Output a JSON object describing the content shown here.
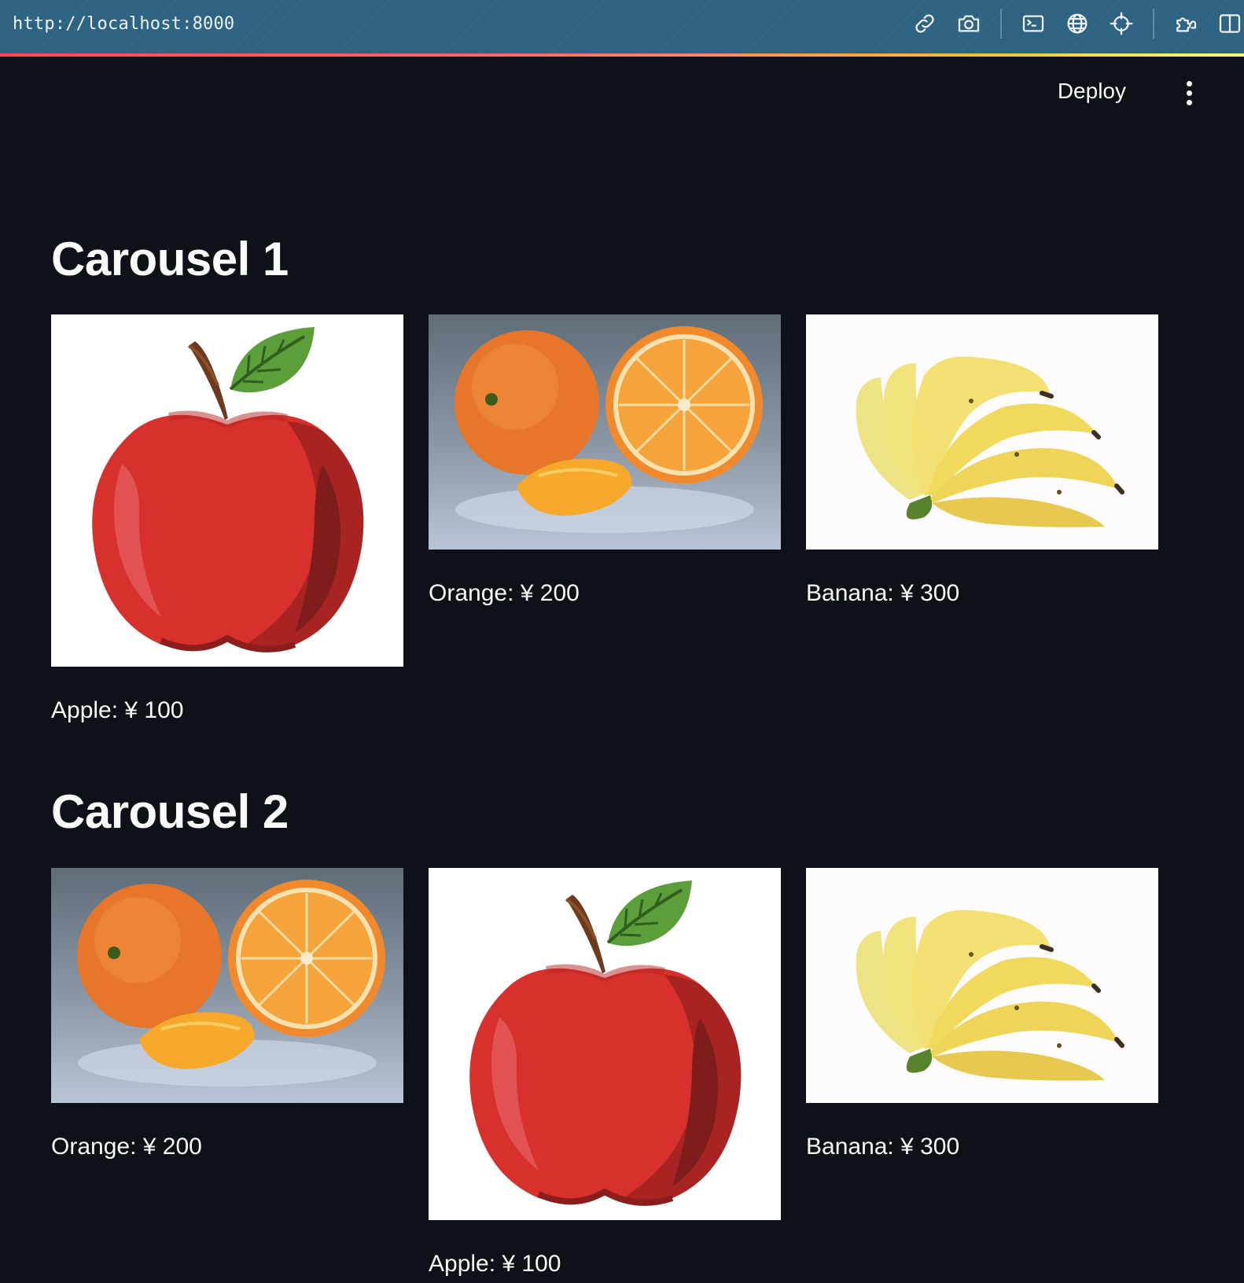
{
  "browser": {
    "url": "http://localhost:8000",
    "tools": [
      "link-icon",
      "camera-icon",
      "terminal-icon",
      "globe-icon",
      "crosshair-icon",
      "extension-icon",
      "split-view-icon"
    ]
  },
  "header": {
    "deploy_label": "Deploy",
    "menu_icon": "more-vertical-icon"
  },
  "sections": [
    {
      "title": "Carousel 1",
      "items": [
        {
          "fruit": "apple",
          "caption": "Apple: ¥ 100"
        },
        {
          "fruit": "orange",
          "caption": "Orange: ¥ 200"
        },
        {
          "fruit": "banana",
          "caption": "Banana: ¥ 300"
        }
      ]
    },
    {
      "title": "Carousel 2",
      "items": [
        {
          "fruit": "orange",
          "caption": "Orange: ¥ 200"
        },
        {
          "fruit": "apple",
          "caption": "Apple: ¥ 100"
        },
        {
          "fruit": "banana",
          "caption": "Banana: ¥ 300"
        }
      ]
    }
  ],
  "colors": {
    "background": "#0e1117",
    "toolbar": "#2e6381",
    "text": "#fafafa",
    "accent": "#ff4b4b"
  }
}
